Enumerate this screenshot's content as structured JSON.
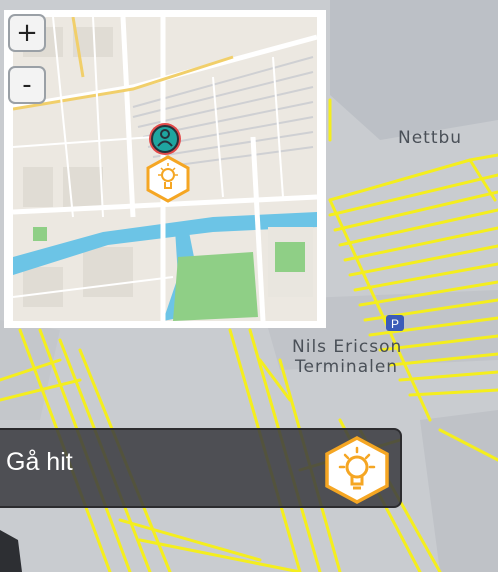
{
  "map": {
    "labels": [
      "Nettbu",
      "Nils Ericson",
      "Terminalen"
    ],
    "colors": {
      "track": "#f4ee1e",
      "ground": "#c9ccd0",
      "building": "#b9bdc3"
    }
  },
  "minimap": {
    "zoom_in_label": "+",
    "zoom_out_label": "-",
    "colors": {
      "water": "#6cc4e6",
      "park": "#8fcf86",
      "land": "#ece8e1",
      "road": "#ffffff",
      "marker": "#f5a623"
    }
  },
  "goto_bar": {
    "label": "Gå hit",
    "icon": "lightbulb-icon",
    "icon_color": "#f5a623"
  }
}
